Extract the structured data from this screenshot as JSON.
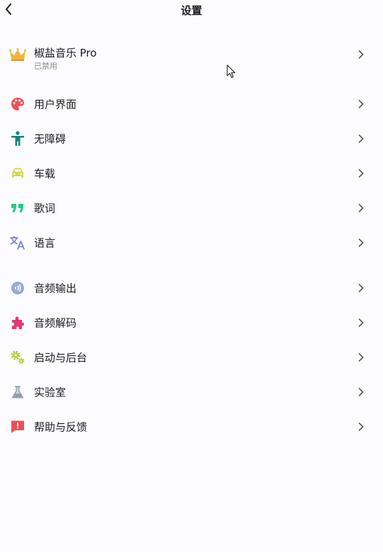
{
  "header": {
    "title": "设置"
  },
  "pro": {
    "label": "椒盐音乐 Pro",
    "status": "已禁用"
  },
  "items": [
    {
      "label": "用户界面",
      "icon": "palette-icon",
      "color": "#ee4f55"
    },
    {
      "label": "无障碍",
      "icon": "accessibility-icon",
      "color": "#13877f"
    },
    {
      "label": "车载",
      "icon": "car-icon",
      "color": "#d5d651"
    },
    {
      "label": "歌词",
      "icon": "quote-icon",
      "color": "#22cc86"
    },
    {
      "label": "语言",
      "icon": "translate-icon",
      "color": "#6673c0"
    },
    {
      "label": "音频输出",
      "icon": "audio-output-icon",
      "color": "#97abd1"
    },
    {
      "label": "音频解码",
      "icon": "puzzle-icon",
      "color": "#e23a73"
    },
    {
      "label": "启动与后台",
      "icon": "gears-icon",
      "color": "#b7cc39"
    },
    {
      "label": "实验室",
      "icon": "flask-icon",
      "color": "#8f9eb5"
    },
    {
      "label": "帮助与反馈",
      "icon": "feedback-icon",
      "color": "#ee4f55"
    }
  ],
  "colors": {
    "crown": "#f0b53f",
    "background": "#fcfbfd",
    "chevron": "#55555a"
  }
}
